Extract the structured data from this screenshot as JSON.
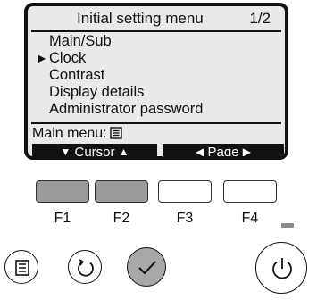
{
  "screen": {
    "title": "Initial setting menu",
    "page": "1/2",
    "menu_items": [
      {
        "label": "Main/Sub",
        "selected": false
      },
      {
        "label": "Clock",
        "selected": true
      },
      {
        "label": "Contrast",
        "selected": false
      },
      {
        "label": "Display details",
        "selected": false
      },
      {
        "label": "Administrator password",
        "selected": false
      }
    ],
    "main_menu_label": "Main menu:",
    "softkeys": {
      "cursor_label": "Cursor",
      "page_label": "Page"
    }
  },
  "function_keys": [
    {
      "label": "F1",
      "active": true
    },
    {
      "label": "F2",
      "active": true
    },
    {
      "label": "F3",
      "active": false
    },
    {
      "label": "F4",
      "active": false
    }
  ],
  "buttons": {
    "menu": "menu-icon",
    "return": "return-icon",
    "select": "checkmark-icon",
    "power": "power-icon"
  },
  "colors": {
    "lcd_background": "#e9e9e9",
    "active_key": "#9b9b9b",
    "select_button": "#a8a8a8"
  }
}
